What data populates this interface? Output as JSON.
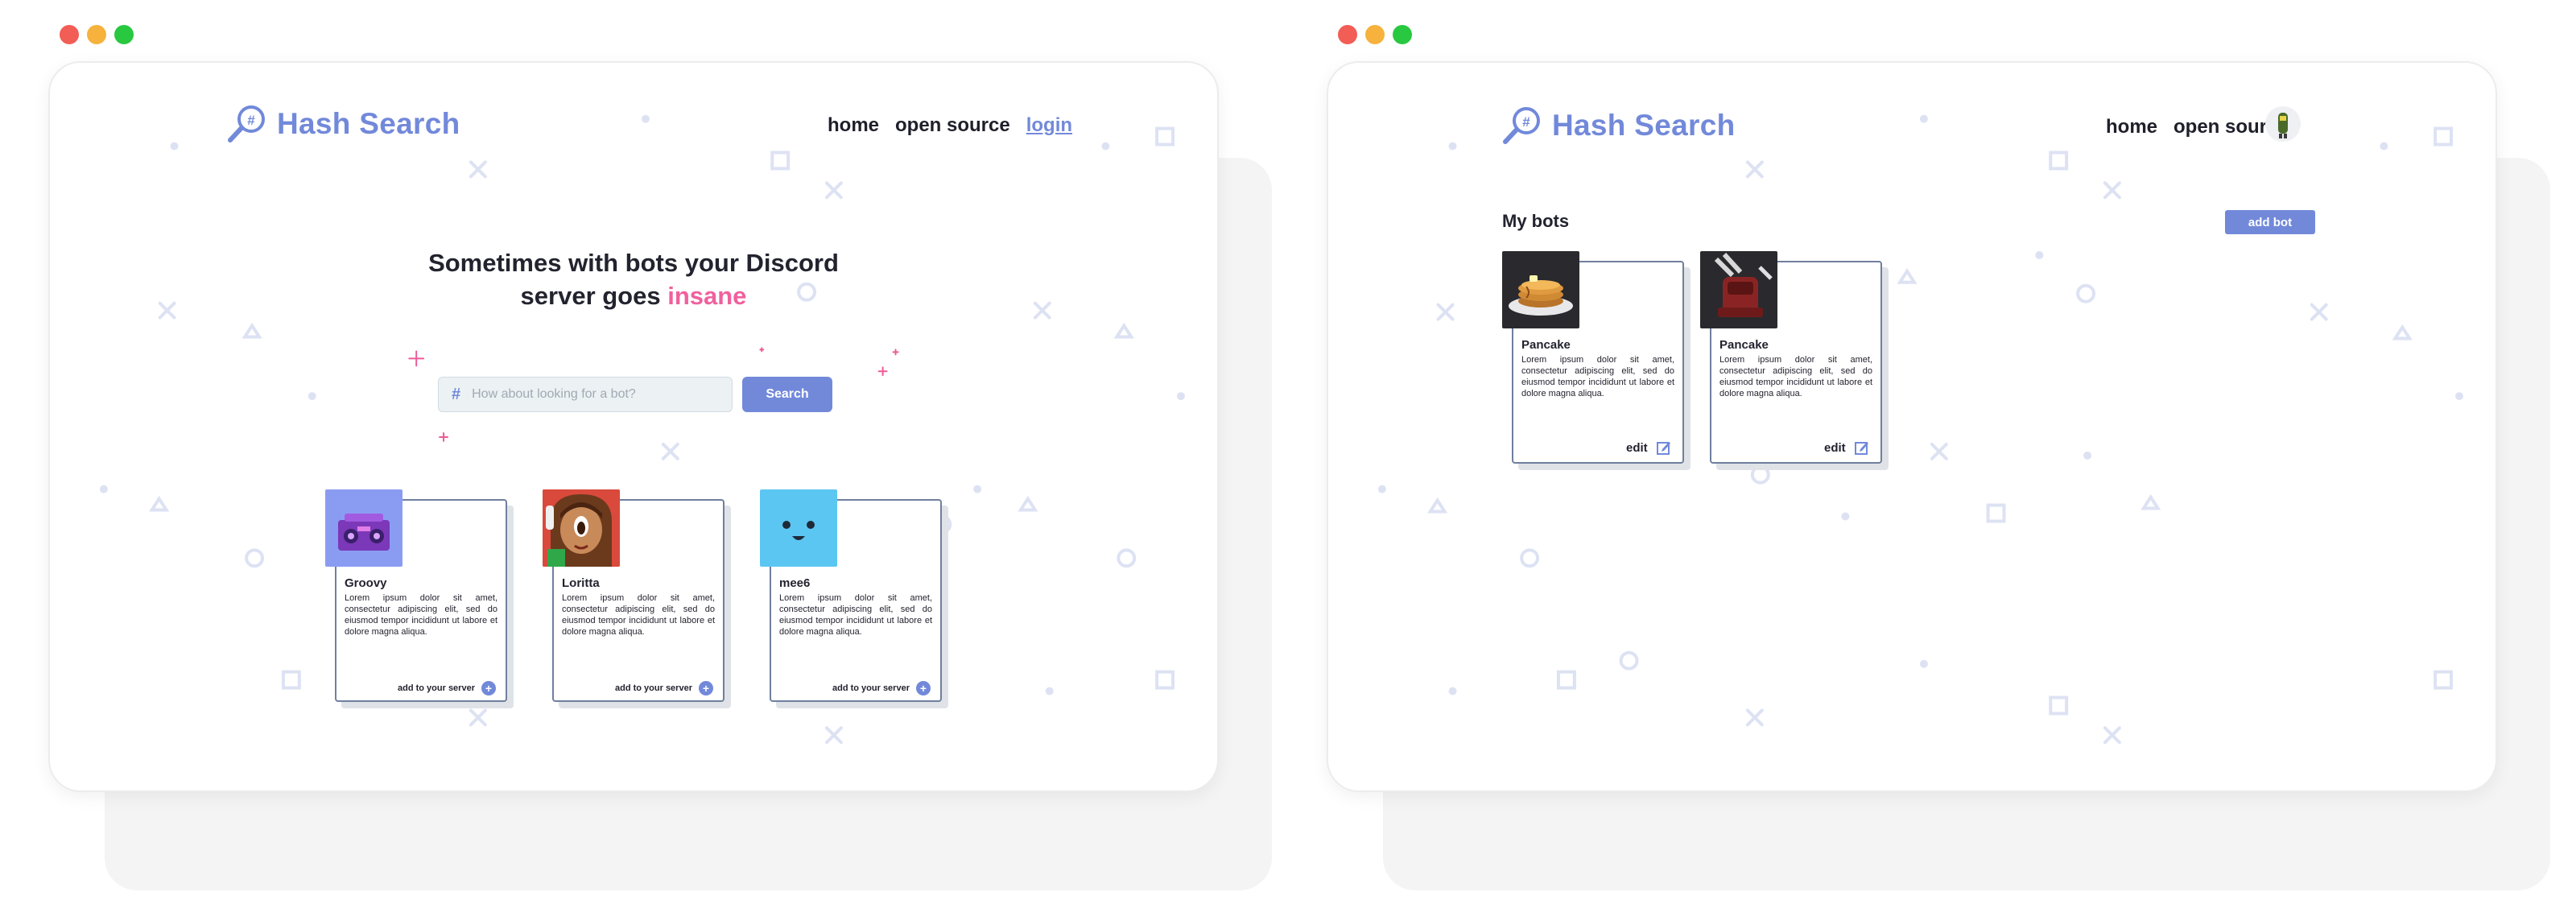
{
  "colors": {
    "brand": "#7289da",
    "accent_pink": "#f0609e",
    "text_dark": "#23232f",
    "traffic_red": "#f25d55",
    "traffic_yellow": "#f6b23d",
    "traffic_green": "#28c840"
  },
  "logo": {
    "text": "Hash Search",
    "icon": "magnifier-hash-icon"
  },
  "window1": {
    "nav": {
      "home": "home",
      "open_source": "open source",
      "login": "login"
    },
    "hero": {
      "line1": "Sometimes with bots your Discord",
      "line2_prefix": "server goes ",
      "highlight": "insane"
    },
    "search": {
      "placeholder": "How about looking for a bot?",
      "button": "Search",
      "icon": "hash-icon"
    },
    "bots": [
      {
        "name": "Groovy",
        "description": "Lorem ipsum dolor sit amet, consectetur adipiscing elit, sed do eiusmod tempor incididunt ut labore et dolore magna aliqua.",
        "action": "add to your server",
        "avatar": "boombox-avatar"
      },
      {
        "name": "Loritta",
        "description": "Lorem ipsum dolor sit amet, consectetur adipiscing elit, sed do eiusmod tempor incididunt ut labore et dolore magna aliqua.",
        "action": "add to your server",
        "avatar": "girl-avatar"
      },
      {
        "name": "mee6",
        "description": "Lorem ipsum dolor sit amet, consectetur adipiscing elit, sed do eiusmod tempor incididunt ut labore et dolore magna aliqua.",
        "action": "add to your server",
        "avatar": "blue-face-avatar"
      }
    ]
  },
  "window2": {
    "nav": {
      "home": "home",
      "open_source": "open source"
    },
    "section_title": "My bots",
    "add_button": "add bot",
    "bots": [
      {
        "name": "Pancake",
        "description": "Lorem ipsum dolor sit amet, consectetur adipiscing elit, sed do eiusmod tempor incididunt ut labore et dolore magna aliqua.",
        "action": "edit",
        "avatar": "pancake-avatar"
      },
      {
        "name": "Pancake",
        "description": "Lorem ipsum dolor sit amet, consectetur adipiscing elit, sed do eiusmod tempor incididunt ut labore et dolore magna aliqua.",
        "action": "edit",
        "avatar": "robot-avatar"
      }
    ]
  }
}
